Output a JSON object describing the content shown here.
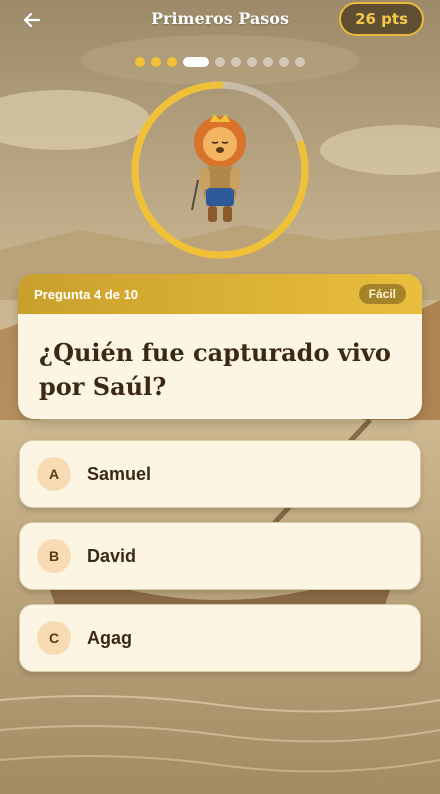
{
  "header": {
    "title": "Primeros Pasos",
    "points": "26 pts"
  },
  "progress": {
    "total": 10,
    "current": 4
  },
  "timer": {
    "remaining_fraction": 0.8
  },
  "question": {
    "counter": "Pregunta 4 de 10",
    "difficulty": "Fácil",
    "text": "¿Quién fue capturado vivo por Saúl?"
  },
  "options": [
    {
      "letter": "A",
      "label": "Samuel"
    },
    {
      "letter": "B",
      "label": "David"
    },
    {
      "letter": "C",
      "label": "Agag"
    }
  ],
  "colors": {
    "accent_gold": "#f0c136",
    "card_bg": "#fdf5e4",
    "text_dark": "#3b2a13"
  }
}
